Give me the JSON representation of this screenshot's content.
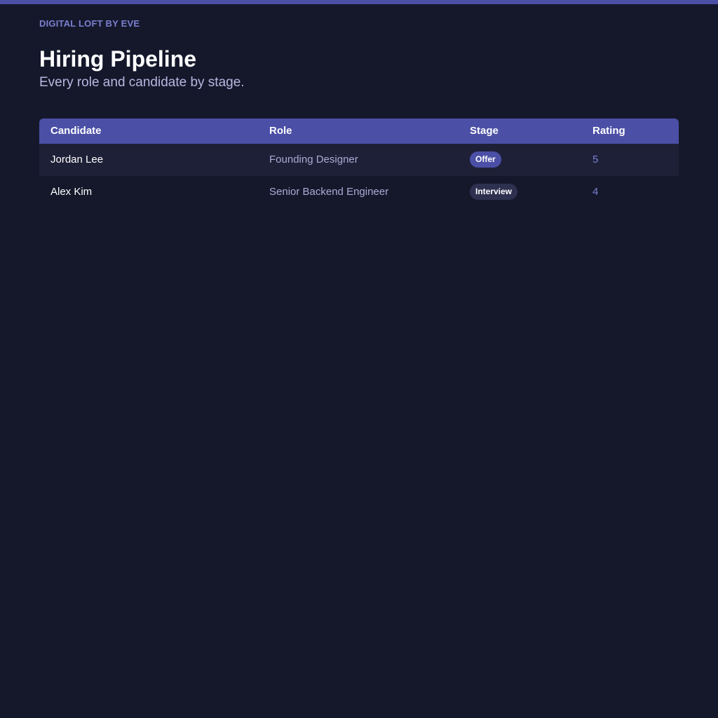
{
  "brand": "DIGITAL LOFT BY EVE",
  "header": {
    "title": "Hiring Pipeline",
    "subtitle": "Every role and candidate by stage."
  },
  "table": {
    "columns": [
      "Candidate",
      "Role",
      "Stage",
      "Rating"
    ],
    "rows": [
      {
        "candidate": "Jordan Lee",
        "role": "Founding Designer",
        "stage": "Offer",
        "rating": "5"
      },
      {
        "candidate": "Alex Kim",
        "role": "Senior Backend Engineer",
        "stage": "Interview",
        "rating": "4"
      }
    ]
  },
  "colors": {
    "accent": "#4b4fa6",
    "background": "#15182b",
    "muted_text": "#a9abd4",
    "rating_text": "#7a7fd0"
  }
}
